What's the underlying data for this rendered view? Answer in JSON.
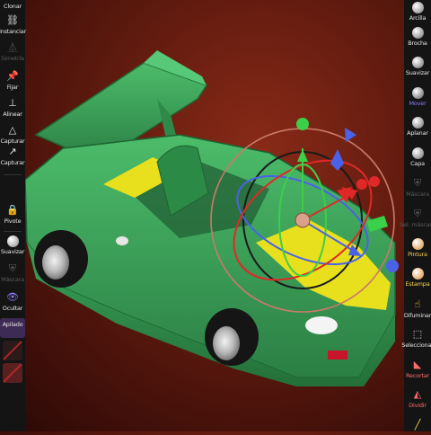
{
  "left_toolbar": {
    "items": [
      {
        "label": "Clonar"
      },
      {
        "label": "Instanciar"
      },
      {
        "label": "Simetría"
      },
      {
        "label": "Fijar"
      },
      {
        "label": "Alinear"
      },
      {
        "label": "Capturar"
      },
      {
        "label": "Capturar"
      },
      {
        "label": "Pivote"
      },
      {
        "label": "Suavizar"
      },
      {
        "label": "Máscara"
      },
      {
        "label": "Ocultar"
      },
      {
        "label": "Apilado"
      }
    ]
  },
  "right_toolbar": {
    "items": [
      {
        "label": "Arcilla"
      },
      {
        "label": "Brocha"
      },
      {
        "label": "Suavizar"
      },
      {
        "label": "Mover"
      },
      {
        "label": "Aplanar"
      },
      {
        "label": "Capa"
      },
      {
        "label": "Máscara"
      },
      {
        "label": "Sel. máscara"
      },
      {
        "label": "Pintura"
      },
      {
        "label": "Estampa"
      },
      {
        "label": "Difuminar"
      },
      {
        "label": "Seleccionar"
      },
      {
        "label": "Recortar"
      },
      {
        "label": "Dividir"
      }
    ]
  },
  "colors": {
    "car_body": "#3ca05a",
    "car_highlight": "#e8e01c",
    "background": "#6a1e10",
    "gizmo_x": "#e02828",
    "gizmo_y": "#3ad04a",
    "gizmo_z": "#4a62e8",
    "accent": "#8b7cff"
  }
}
